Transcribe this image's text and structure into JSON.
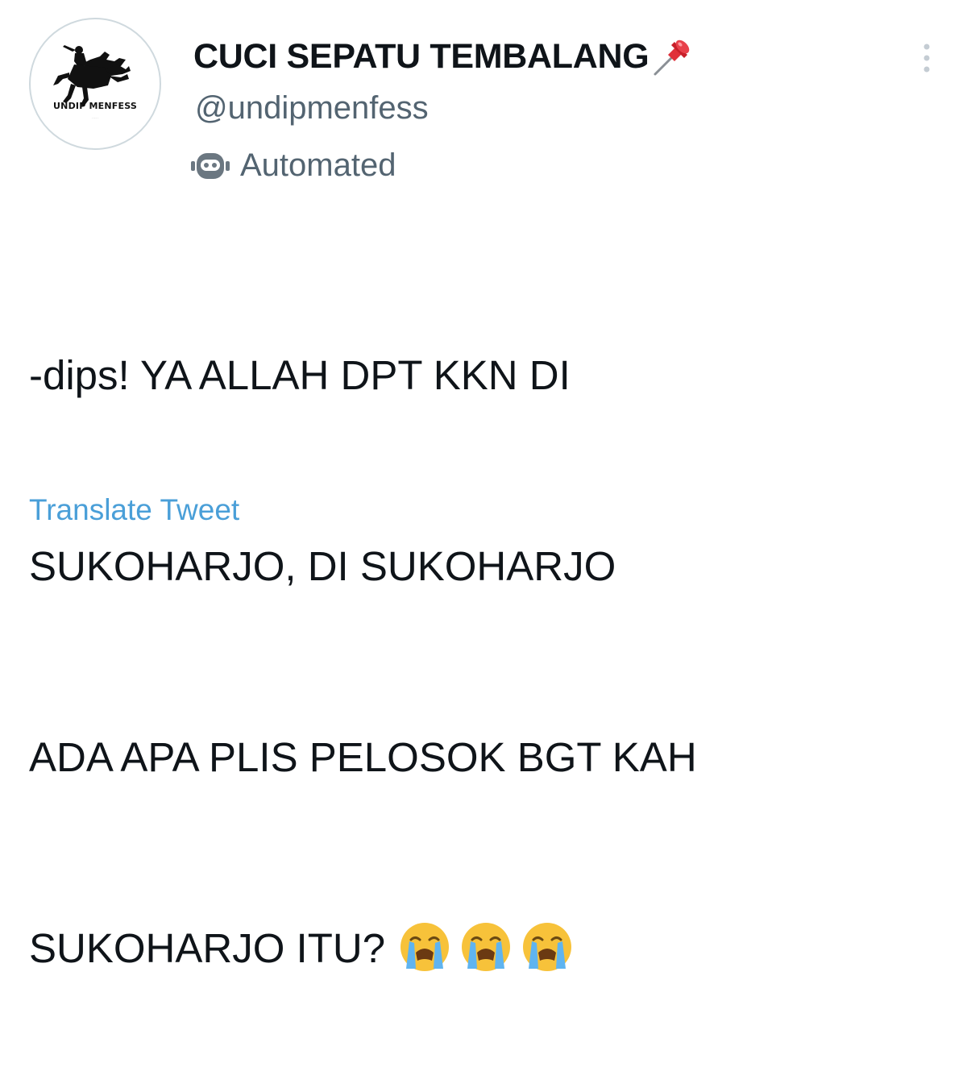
{
  "account": {
    "display_name": "CUCI SEPATU TEMBALANG",
    "handle": "@undipmenfess",
    "label": "Automated",
    "avatar_text": "UNDIP MENFESS",
    "name_emoji": "pushpin-icon",
    "label_icon": "bot-icon"
  },
  "tweet": {
    "lines": [
      "-dips! YA ALLAH DPT KKN DI",
      "SUKOHARJO, DI SUKOHARJO",
      "ADA APA PLIS PELOSOK BGT KAH",
      "SUKOHARJO ITU?"
    ],
    "trailing_emojis": [
      "loudly-crying-face-icon",
      "loudly-crying-face-icon",
      "loudly-crying-face-icon"
    ]
  },
  "actions": {
    "translate_label": "Translate Tweet",
    "more_icon": "more-vertical-icon"
  },
  "colors": {
    "text": "#0f1419",
    "muted": "#536471",
    "link": "#4a9fd8",
    "avatar_border": "#cfd9de"
  }
}
